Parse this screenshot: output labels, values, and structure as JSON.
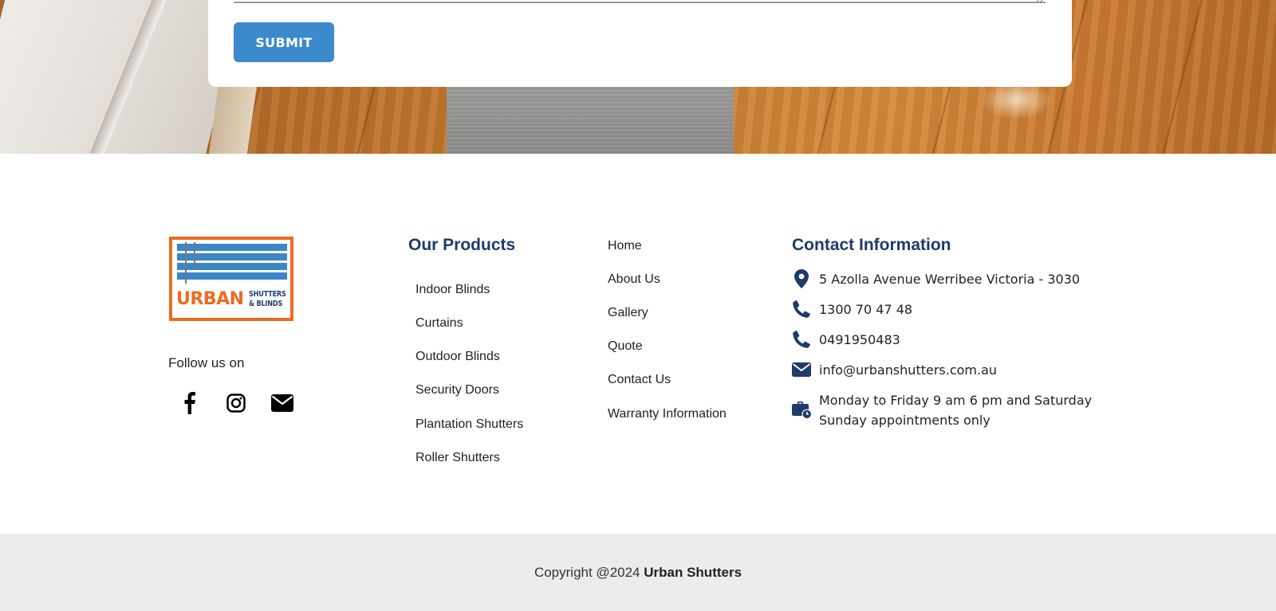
{
  "form": {
    "submit_label": "SUBMIT"
  },
  "brand": {
    "logo_word": "URBAN",
    "logo_sub_line1": "SHUTTERS",
    "logo_sub_line2": "& BLINDS",
    "colors": {
      "orange": "#ee6a22",
      "blue": "#3a86c8",
      "navy": "#1d3a6b"
    }
  },
  "social": {
    "follow_label": "Follow us on",
    "icons": [
      "facebook-icon",
      "instagram-icon",
      "envelope-icon"
    ]
  },
  "products": {
    "title": "Our Products",
    "items": [
      "Indoor Blinds",
      "Curtains",
      "Outdoor Blinds",
      "Security Doors",
      "Plantation Shutters",
      "Roller Shutters"
    ]
  },
  "nav": {
    "items": [
      "Home",
      "About Us",
      "Gallery",
      "Quote",
      "Contact Us",
      "Warranty Information"
    ]
  },
  "contact": {
    "title": "Contact Information",
    "address": "5 Azolla Avenue Werribee Victoria - 3030",
    "phone1": "1300 70 47 48",
    "phone2": "0491950483",
    "email": "info@urbanshutters.com.au",
    "hours_line1": "Monday to Friday 9 am 6 pm and Saturday",
    "hours_line2": "Sunday appointments only"
  },
  "footer": {
    "copyright_prefix": "Copyright @2024",
    "copyright_brand": "Urban Shutters"
  }
}
